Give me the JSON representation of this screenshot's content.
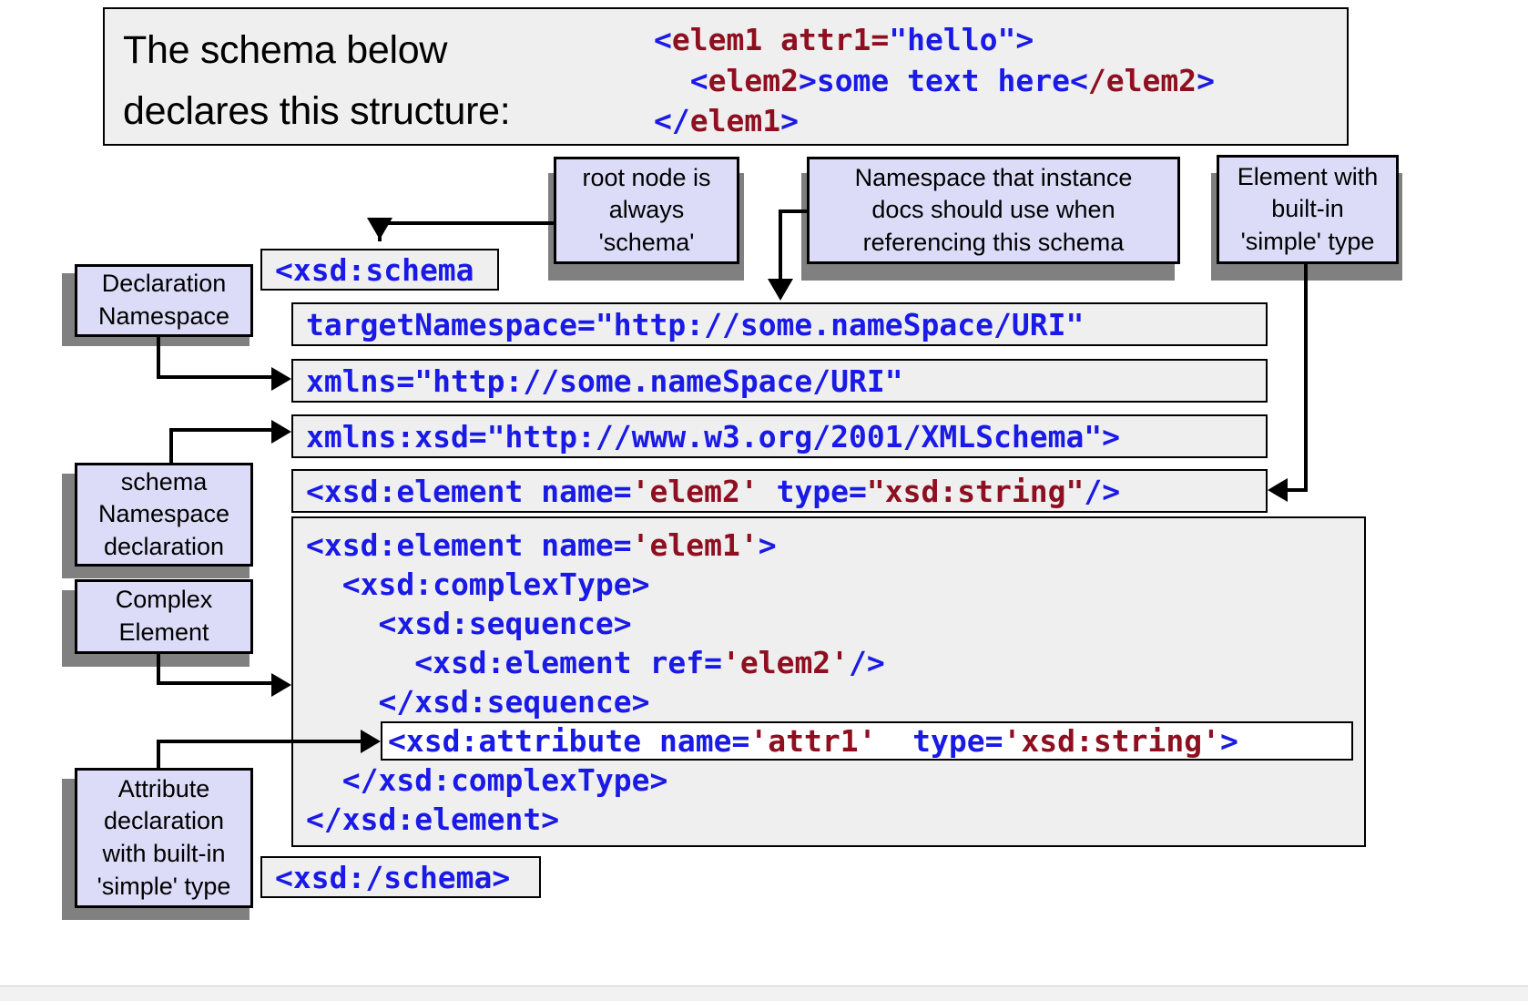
{
  "header": {
    "caption_line1": "The schema below",
    "caption_line2": "declares this structure:",
    "xml_sample": {
      "line1": {
        "open": "<elem1 attr1=\"hello\">",
        "tag_open_br": "<",
        "name": "elem1 attr1=",
        "val": "\"hello\"",
        "close_br": ">"
      },
      "l1_a": "<",
      "l1_b": "elem1 attr1=",
      "l1_c": "\"hello\"",
      "l1_d": ">",
      "l2_a": "  <",
      "l2_b": "elem2",
      "l2_c": ">some text here<",
      "l2_d": "/elem2",
      "l2_e": ">",
      "l3_a": "</",
      "l3_b": "elem1",
      "l3_c": ">"
    }
  },
  "callouts": {
    "root_node": "root node is always 'schema'",
    "root_node_lines": [
      "root node is",
      "always",
      "'schema'"
    ],
    "namespace_instance": "Namespace that instance docs should use when referencing this schema",
    "namespace_instance_lines": [
      "Namespace that instance",
      "docs should use when",
      "referencing this schema"
    ],
    "element_builtin": "Element with built-in 'simple' type",
    "element_builtin_lines": [
      "Element with",
      "built-in",
      "'simple' type"
    ],
    "declaration_namespace": "Declaration Namespace",
    "declaration_namespace_lines": [
      "Declaration",
      "Namespace"
    ],
    "schema_namespace_decl": "schema Namespace declaration",
    "schema_namespace_decl_lines": [
      "schema",
      "Namespace",
      "declaration"
    ],
    "complex_element": "Complex Element",
    "complex_element_lines": [
      "Complex",
      "Element"
    ],
    "attribute_declaration": "Attribute declaration with built-in 'simple' type",
    "attribute_declaration_lines": [
      "Attribute",
      "declaration",
      "with built-in",
      "'simple' type"
    ]
  },
  "code": {
    "schema_open": "<xsd:schema",
    "target_namespace": "targetNamespace=\"http://some.nameSpace/URI\"",
    "xmlns_default": "xmlns=\"http://some.nameSpace/URI\"",
    "xmlns_xsd": "xmlns:xsd=\"http://www.w3.org/2001/XMLSchema\">",
    "element_elem2_a": "<xsd:element name=",
    "element_elem2_b": "'elem2'",
    "element_elem2_c": " type=",
    "element_elem2_d": "\"xsd:string\"",
    "element_elem2_e": "/>",
    "element_elem2_full": "<xsd:element name='elem2' type=\"xsd:string\"/>",
    "elem1_open_a": "<xsd:element name=",
    "elem1_open_b": "'elem1'",
    "elem1_open_c": ">",
    "complextype_open": "  <xsd:complexType>",
    "sequence_open": "    <xsd:sequence>",
    "ref_elem2_a": "      <xsd:element ref=",
    "ref_elem2_b": "'elem2'",
    "ref_elem2_c": "/>",
    "sequence_close": "    </xsd:sequence>",
    "attribute_a": "<xsd:attribute name=",
    "attribute_b": "'attr1'",
    "attribute_c": "  type=",
    "attribute_d": "'xsd:string'",
    "attribute_e": ">",
    "attribute_full": "<xsd:attribute name='attr1'  type='xsd:string'>",
    "complextype_close": "  </xsd:complexType>",
    "element_close": "</xsd:element>",
    "schema_close": "<xsd:/schema>"
  },
  "colors": {
    "markup_blue": "#1a1ae6",
    "name_red": "#8e1020",
    "callout_fill": "#DDDCF8",
    "code_fill": "#EFEFEF",
    "shadow": "#808080"
  }
}
